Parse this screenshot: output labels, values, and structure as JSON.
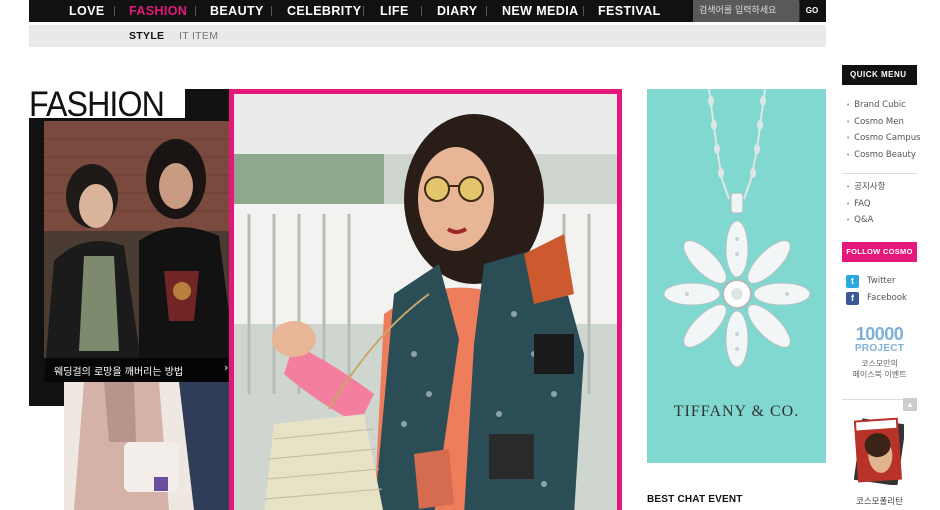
{
  "nav": {
    "items": [
      {
        "label": "LOVE",
        "active": false
      },
      {
        "label": "FASHION",
        "active": true
      },
      {
        "label": "BEAUTY",
        "active": false
      },
      {
        "label": "CELEBRITY",
        "active": false
      },
      {
        "label": "LIFE",
        "active": false
      },
      {
        "label": "DIARY",
        "active": false
      },
      {
        "label": "NEW MEDIA",
        "active": false
      },
      {
        "label": "FESTIVAL",
        "active": false
      }
    ],
    "search_placeholder": "검색어를 입력하세요",
    "go_label": "GO"
  },
  "subnav": {
    "items": [
      {
        "label": "STYLE",
        "active": true
      },
      {
        "label": "IT ITEM",
        "active": false
      }
    ]
  },
  "main": {
    "section_title": "FASHION",
    "feature_caption": "웨딩걸의 로망을 깨버리는 방법",
    "caption_arrow": "›"
  },
  "ad": {
    "brand": "TIFFANY & CO."
  },
  "best_chat": "BEST CHAT EVENT",
  "quick_menu": {
    "title": "QUICK MENU",
    "links": [
      "Brand Cubic",
      "Cosmo Men",
      "Cosmo Campus",
      "Cosmo Beauty"
    ],
    "info_links": [
      "공지사항",
      "FAQ",
      "Q&A"
    ],
    "follow_label": "FOLLOW COSMO",
    "social": [
      {
        "label": "Twitter",
        "icon": "t",
        "color": "#2aa9e0"
      },
      {
        "label": "Facebook",
        "icon": "f",
        "color": "#3b5998"
      }
    ],
    "project_number": "10000",
    "project_label": "PROJECT",
    "project_desc_1": "코스모만의",
    "project_desc_2": "페이스북 이벤트",
    "up_arrow": "▲",
    "magazine_caption": "코스모폴리탄"
  },
  "colors": {
    "accent": "#e4187a",
    "tiffany": "#81d8d0"
  }
}
